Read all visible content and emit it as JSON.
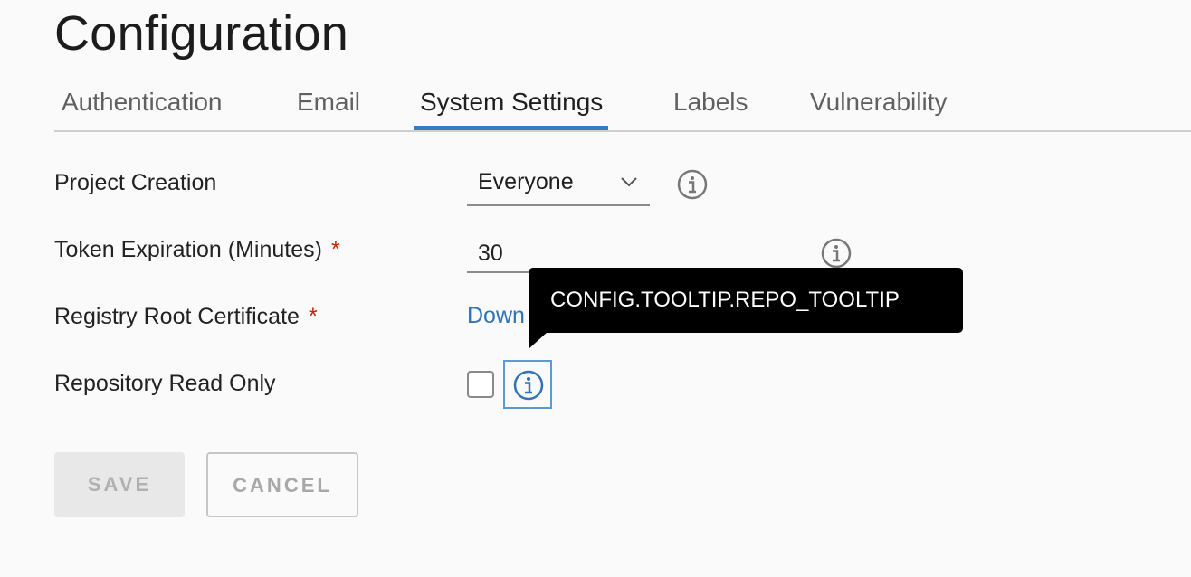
{
  "page": {
    "title": "Configuration"
  },
  "tabs": [
    {
      "label": "Authentication",
      "active": false
    },
    {
      "label": "Email",
      "active": false
    },
    {
      "label": "System Settings",
      "active": true
    },
    {
      "label": "Labels",
      "active": false
    },
    {
      "label": "Vulnerability",
      "active": false
    }
  ],
  "form": {
    "project_creation": {
      "label": "Project Creation",
      "value": "Everyone"
    },
    "token_expiration": {
      "label": "Token Expiration (Minutes)",
      "required_mark": "*",
      "value": "30"
    },
    "root_certificate": {
      "label": "Registry Root Certificate",
      "required_mark": "*",
      "link_text": "Down"
    },
    "read_only": {
      "label": "Repository Read Only",
      "checked": false
    }
  },
  "tooltip": {
    "text": "CONFIG.TOOLTIP.REPO_TOOLTIP"
  },
  "buttons": {
    "save": "SAVE",
    "cancel": "CANCEL"
  },
  "colors": {
    "accent": "#3a7bbf",
    "link": "#2f73b8",
    "required": "#c92100",
    "tooltip_bg": "#000000"
  },
  "icons": [
    "chevron-down-icon",
    "info-icon"
  ]
}
